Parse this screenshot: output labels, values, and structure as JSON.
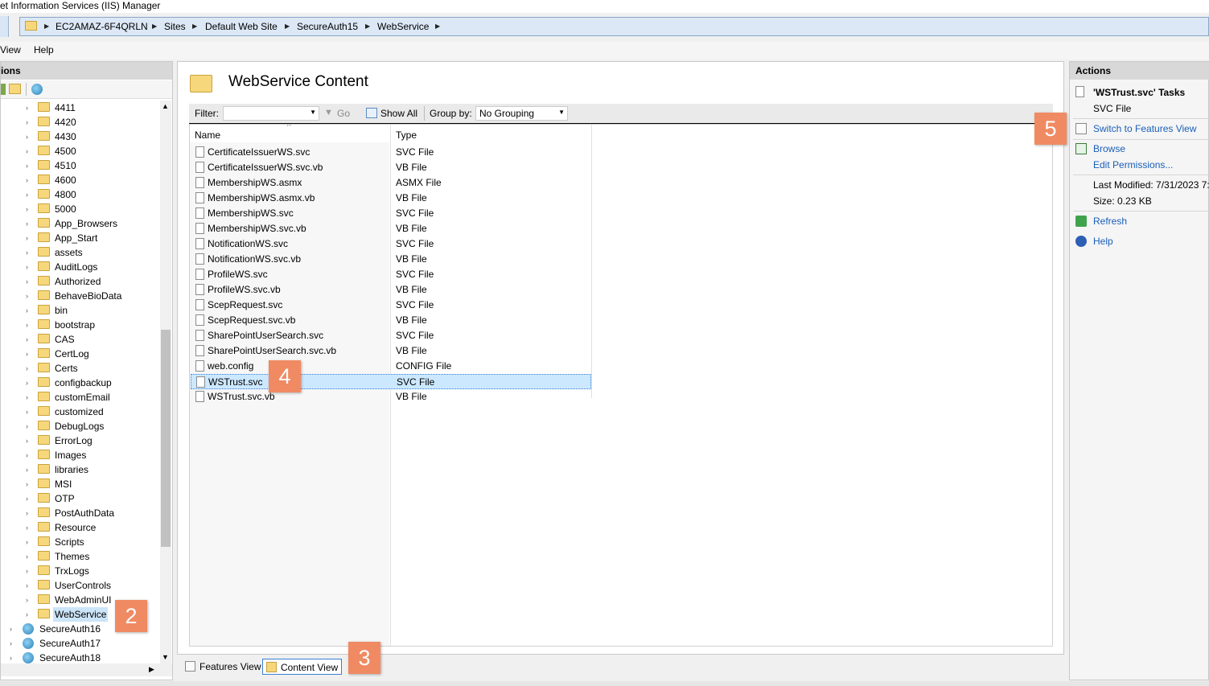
{
  "window": {
    "title": "et Information Services (IIS) Manager"
  },
  "breadcrumb": [
    "EC2AMAZ-6F4QRLN",
    "Sites",
    "Default Web Site",
    "SecureAuth15",
    "WebService"
  ],
  "menu": {
    "view": "View",
    "help": "Help"
  },
  "connections": {
    "header": "ions",
    "tree": [
      "4411",
      "4420",
      "4430",
      "4500",
      "4510",
      "4600",
      "4800",
      "5000",
      "App_Browsers",
      "App_Start",
      "assets",
      "AuditLogs",
      "Authorized",
      "BehaveBioData",
      "bin",
      "bootstrap",
      "CAS",
      "CertLog",
      "Certs",
      "configbackup",
      "customEmail",
      "customized",
      "DebugLogs",
      "ErrorLog",
      "Images",
      "libraries",
      "MSI",
      "OTP",
      "PostAuthData",
      "Resource",
      "Scripts",
      "Themes",
      "TrxLogs",
      "UserControls",
      "WebAdminUI",
      "WebService"
    ],
    "selected": "WebService",
    "sites": [
      "SecureAuth16",
      "SecureAuth17",
      "SecureAuth18"
    ]
  },
  "main": {
    "title": "WebService Content",
    "filter_label": "Filter:",
    "go_label": "Go",
    "show_all_label": "Show All",
    "group_by_label": "Group by:",
    "group_by_value": "No Grouping",
    "columns": {
      "name": "Name",
      "type": "Type"
    },
    "files": [
      {
        "name": "CertificateIssuerWS.svc",
        "type": "SVC File"
      },
      {
        "name": "CertificateIssuerWS.svc.vb",
        "type": "VB File"
      },
      {
        "name": "MembershipWS.asmx",
        "type": "ASMX File"
      },
      {
        "name": "MembershipWS.asmx.vb",
        "type": "VB File"
      },
      {
        "name": "MembershipWS.svc",
        "type": "SVC File"
      },
      {
        "name": "MembershipWS.svc.vb",
        "type": "VB File"
      },
      {
        "name": "NotificationWS.svc",
        "type": "SVC File"
      },
      {
        "name": "NotificationWS.svc.vb",
        "type": "VB File"
      },
      {
        "name": "ProfileWS.svc",
        "type": "SVC File"
      },
      {
        "name": "ProfileWS.svc.vb",
        "type": "VB File"
      },
      {
        "name": "ScepRequest.svc",
        "type": "SVC File"
      },
      {
        "name": "ScepRequest.svc.vb",
        "type": "VB File"
      },
      {
        "name": "SharePointUserSearch.svc",
        "type": "SVC File"
      },
      {
        "name": "SharePointUserSearch.svc.vb",
        "type": "VB File"
      },
      {
        "name": "web.config",
        "type": "CONFIG File"
      },
      {
        "name": "WSTrust.svc",
        "type": "SVC File"
      },
      {
        "name": "WSTrust.svc.vb",
        "type": "VB File"
      }
    ],
    "selected_file": "WSTrust.svc"
  },
  "view_tabs": {
    "features": "Features View",
    "content": "Content View"
  },
  "actions": {
    "header": "Actions",
    "task_title": "'WSTrust.svc' Tasks",
    "file_type": "SVC File",
    "switch_features": "Switch to Features View",
    "browse": "Browse",
    "edit_permissions": "Edit Permissions...",
    "last_modified": "Last Modified: 7/31/2023 7:",
    "size": "Size: 0.23 KB",
    "refresh": "Refresh",
    "help": "Help"
  },
  "callouts": [
    "2",
    "3",
    "4",
    "5"
  ],
  "colors": {
    "selection": "#cce8ff",
    "link": "#1a5eb8",
    "callout": "#f08a63"
  }
}
